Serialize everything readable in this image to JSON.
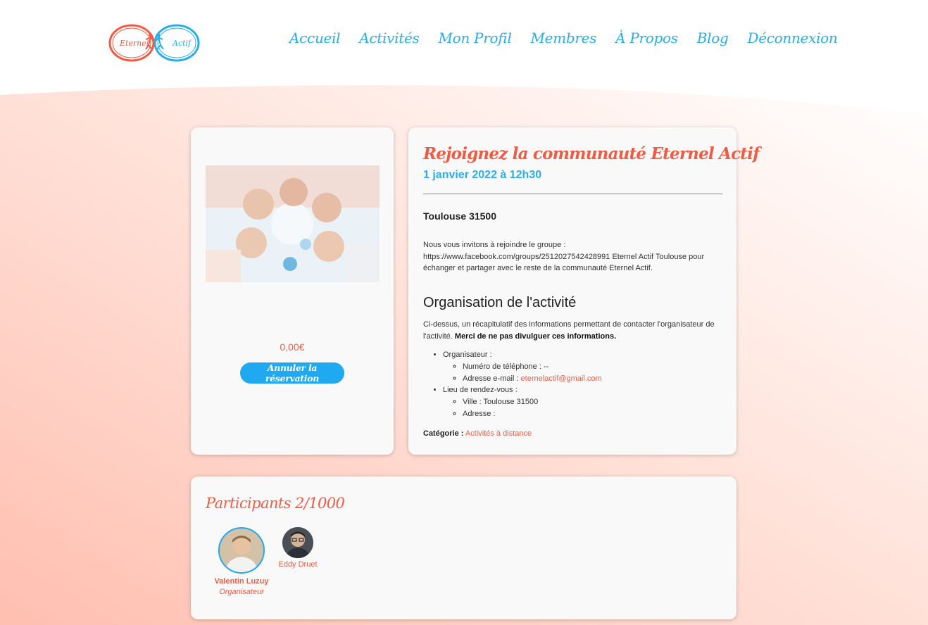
{
  "nav": {
    "items": [
      "Accueil",
      "Activités",
      "Mon Profil",
      "Membres",
      "À Propos",
      "Blog",
      "Déconnexion"
    ],
    "logo_left_text": "Eternel",
    "logo_right_text": "Actif"
  },
  "colors": {
    "brand_orange": "#ef5b43",
    "brand_blue": "#2aaee6",
    "button_blue": "#1ea9f0",
    "background_peach": "#fdd8cf"
  },
  "activity": {
    "price": "0,00€",
    "cancel_label": "Annuler la réservation",
    "title": "Rejoignez la communauté Eternel Actif",
    "date": "1 janvier 2022 à 12h30",
    "location": "Toulouse 31500",
    "description_line1": "Nous vous invitons à rejoindre le groupe :",
    "description_line2": "https://www.facebook.com/groups/2512027542428991 Eternel Actif Toulouse pour",
    "description_line3": "échanger et partager avec le reste de la communauté Eternel Actif."
  },
  "organisation": {
    "title": "Organisation de l'activité",
    "intro": "Ci-dessus, un récapitulatif des informations permettant de contacter l'organisateur de l'activité.",
    "intro_bold": "Merci de ne pas divulguer ces informations.",
    "organizer_label": "Organisateur :",
    "phone": "Numéro de téléphone : --",
    "email_label": "Adresse e-mail :",
    "email": "eternelactif@gmail.com",
    "meeting_label": "Lieu de rendez-vous :",
    "city": "Ville : Toulouse 31500",
    "address": "Adresse :",
    "category_label": "Catégorie :",
    "category_value": "Activités à distance"
  },
  "participants": {
    "title": "Participants 2/1000",
    "list": [
      {
        "name": "Valentin Luzuy",
        "role": "Organisateur"
      },
      {
        "name": "Eddy Druet",
        "role": ""
      }
    ]
  }
}
